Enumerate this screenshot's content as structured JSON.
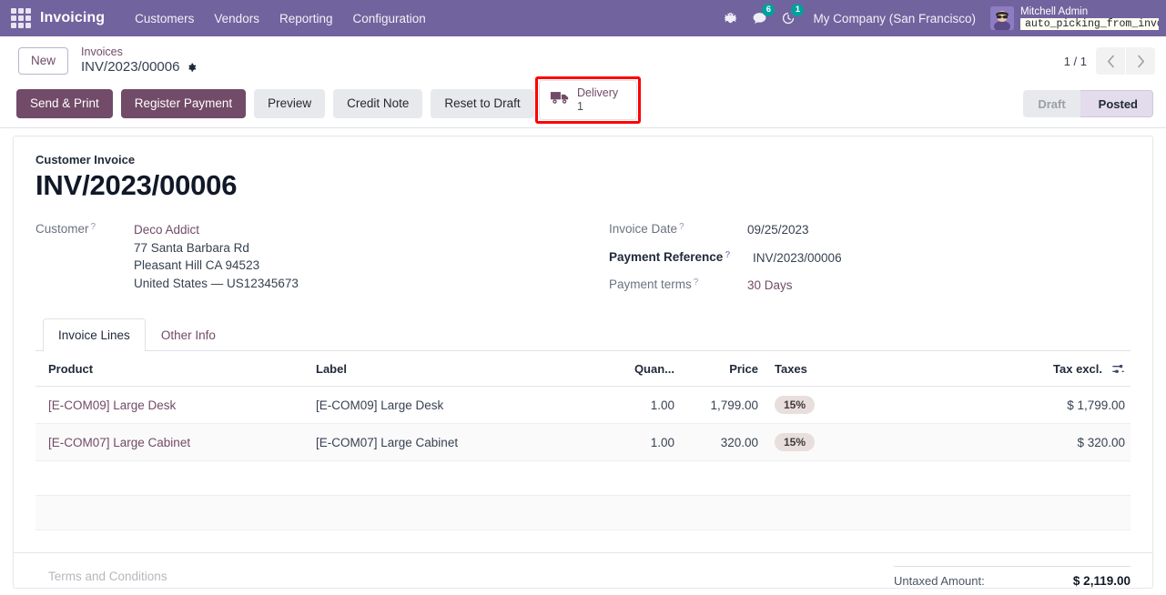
{
  "navbar": {
    "apps_icon": "apps-grid-icon",
    "brand": "Invoicing",
    "menu": [
      {
        "label": "Customers"
      },
      {
        "label": "Vendors"
      },
      {
        "label": "Reporting"
      },
      {
        "label": "Configuration"
      }
    ],
    "icons": {
      "debug": "bug-icon",
      "messages": "chat-icon",
      "messages_count": "6",
      "activities": "clock-icon",
      "activities_count": "1"
    },
    "company": "My Company (San Francisco)",
    "user_name": "Mitchell Admin",
    "database_tag": "auto_picking_from_invoic…",
    "accent": "#71639e",
    "badge_color": "#00a09d"
  },
  "control_panel": {
    "new_button": "New",
    "breadcrumb_parent": "Invoices",
    "breadcrumb_current": "INV/2023/00006",
    "gear_icon": "gear-icon",
    "smart_button": {
      "icon": "truck-icon",
      "label": "Delivery",
      "value": "1",
      "highlight_color": "#ff0000"
    },
    "pager": {
      "text": "1 / 1",
      "prev_icon": "chevron-left-icon",
      "next_icon": "chevron-right-icon"
    },
    "buttons": [
      {
        "label": "Send & Print",
        "style": "primary"
      },
      {
        "label": "Register Payment",
        "style": "primary"
      },
      {
        "label": "Preview",
        "style": "secondary"
      },
      {
        "label": "Credit Note",
        "style": "secondary"
      },
      {
        "label": "Reset to Draft",
        "style": "secondary"
      }
    ],
    "status": {
      "draft": "Draft",
      "posted": "Posted",
      "active": "Posted"
    }
  },
  "form": {
    "doc_type": "Customer Invoice",
    "doc_title": "INV/2023/00006",
    "customer_label": "Customer",
    "customer_name": "Deco Addict",
    "customer_address": [
      "77 Santa Barbara Rd",
      "Pleasant Hill CA 94523",
      "United States — US12345673"
    ],
    "invoice_date_label": "Invoice Date",
    "invoice_date": "09/25/2023",
    "payment_reference_label": "Payment Reference",
    "payment_reference": "INV/2023/00006",
    "payment_terms_label": "Payment terms",
    "payment_terms": "30 Days"
  },
  "notebook": {
    "tabs": [
      {
        "label": "Invoice Lines",
        "active": true
      },
      {
        "label": "Other Info",
        "active": false
      }
    ]
  },
  "lines_table": {
    "columns": {
      "product": "Product",
      "label": "Label",
      "quantity": "Quan...",
      "price": "Price",
      "taxes": "Taxes",
      "total": "Tax excl."
    },
    "optional_columns_icon": "sliders-icon",
    "rows": [
      {
        "product": "[E-COM09] Large Desk",
        "label": "[E-COM09] Large Desk",
        "quantity": "1.00",
        "price": "1,799.00",
        "tax": "15%",
        "total": "$ 1,799.00"
      },
      {
        "product": "[E-COM07] Large Cabinet",
        "label": "[E-COM07] Large Cabinet",
        "quantity": "1.00",
        "price": "320.00",
        "tax": "15%",
        "total": "$ 320.00"
      }
    ]
  },
  "footer": {
    "terms_placeholder": "Terms and Conditions",
    "untaxed_label": "Untaxed Amount:",
    "untaxed_value": "$ 2,119.00"
  }
}
